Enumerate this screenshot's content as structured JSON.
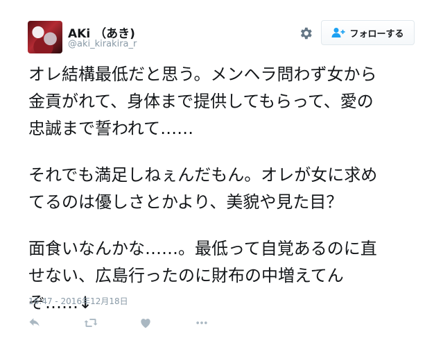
{
  "user": {
    "display_name": "AKi （あき)",
    "handle": "@aki_kirakira_r"
  },
  "follow_button": {
    "label": "フォローする"
  },
  "tweet": {
    "lines_1": [
      "オレ結構最低だと思う。メンヘラ問わず女から",
      "金貢がれて、身体まで提供してもらって、愛の",
      "忠誠まで誓われて……"
    ],
    "lines_2": [
      "それでも満足しねぇんだもん。オレが女に求め",
      "てるのは優しさとかより、美貌や見た目？"
    ],
    "lines_3": [
      "面食いなんかな……。最低って自覚あるのに直",
      "せない、広島行ったのに財布の中増えてん",
      "ぞ……↓"
    ]
  },
  "timestamp": "16:47 - 2016年12月18日",
  "icons": {
    "settings": "gear-icon",
    "follow": "person-add-icon",
    "reply": "reply-icon",
    "retweet": "retweet-icon",
    "like": "heart-icon",
    "more": "more-icon"
  },
  "colors": {
    "text": "#14171a",
    "secondary": "#8899a6",
    "icon": "#aab8c2",
    "follow_icon": "#1da1f2",
    "button_border": "#e1e8ed"
  }
}
